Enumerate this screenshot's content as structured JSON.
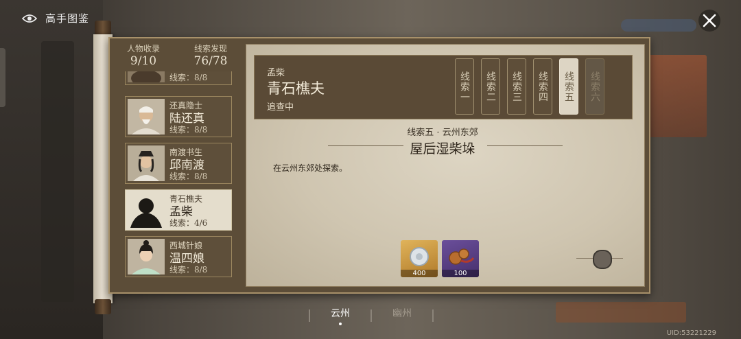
{
  "topbar": {
    "title": "高手图鉴",
    "icon": "eye-icon"
  },
  "stats": {
    "characters_label": "人物收录",
    "characters_value": "9/10",
    "clues_label": "线索发现",
    "clues_value": "76/78"
  },
  "characters": [
    {
      "subtitle": "",
      "name": "",
      "clues": "线索：8/8",
      "active": false
    },
    {
      "subtitle": "还真隐士",
      "name": "陆还真",
      "clues": "线索：8/8",
      "active": false
    },
    {
      "subtitle": "南渡书生",
      "name": "邱南渡",
      "clues": "线索：8/8",
      "active": false
    },
    {
      "subtitle": "青石樵夫",
      "name": "孟柴",
      "clues": "线索：4/6",
      "active": true
    },
    {
      "subtitle": "西城针娘",
      "name": "温四娘",
      "clues": "线索：8/8",
      "active": false
    }
  ],
  "detail": {
    "subtitle": "孟柴",
    "name": "青石樵夫",
    "status": "追查中",
    "tabs": [
      {
        "label": "线索一",
        "state": "normal"
      },
      {
        "label": "线索二",
        "state": "normal"
      },
      {
        "label": "线索三",
        "state": "normal"
      },
      {
        "label": "线索四",
        "state": "normal"
      },
      {
        "label": "线索五",
        "state": "active"
      },
      {
        "label": "线索六",
        "state": "locked"
      }
    ],
    "clue_location": "线索五 · 云州东郊",
    "clue_title": "屋后湿柴垛",
    "clue_desc": "在云州东郊处探索。",
    "rewards": [
      {
        "icon": "silver-coin-icon",
        "count": "400",
        "color": "#c9923a"
      },
      {
        "icon": "copper-coins-icon",
        "count": "100",
        "color": "#5b3f86"
      }
    ]
  },
  "regions": [
    {
      "label": "云州",
      "active": true
    },
    {
      "label": "幽州",
      "active": false
    }
  ],
  "uid": "UID:53221229"
}
